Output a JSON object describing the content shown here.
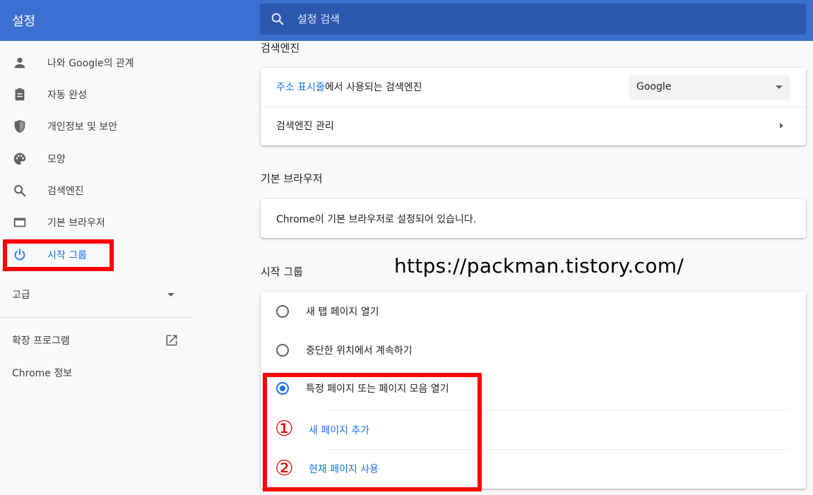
{
  "header": {
    "app_title": "설정",
    "search_placeholder": "설정 검색",
    "color": "#3c70d0"
  },
  "sidebar": {
    "items": [
      {
        "label": "나와 Google의 관계",
        "icon": "person-icon"
      },
      {
        "label": "자동 완성",
        "icon": "clipboard-icon"
      },
      {
        "label": "개인정보 및 보안",
        "icon": "shield-icon"
      },
      {
        "label": "모양",
        "icon": "palette-icon"
      },
      {
        "label": "검색엔진",
        "icon": "search-icon"
      },
      {
        "label": "기본 브라우저",
        "icon": "browser-window-icon"
      },
      {
        "label": "시작 그룹",
        "icon": "power-icon",
        "active": true
      }
    ],
    "advanced_label": "고급",
    "extensions_label": "확장 프로그램",
    "about_label": "Chrome 정보"
  },
  "search_engine": {
    "title": "검색엔진",
    "address_bar_link": "주소 표시줄",
    "address_bar_suffix": "에서 사용되는 검색엔진",
    "selected_engine": "Google",
    "manage_label": "검색엔진 관리"
  },
  "default_browser": {
    "title": "기본 브라우저",
    "status": "Chrome이 기본 브라우저로 설정되어 있습니다."
  },
  "startup": {
    "title": "시작 그룹",
    "options": [
      {
        "label": "새 탭 페이지 열기",
        "checked": false
      },
      {
        "label": "중단한 위치에서 계속하기",
        "checked": false
      },
      {
        "label": "특정 페이지 또는 페이지 모음 열기",
        "checked": true
      }
    ],
    "add_page_label": "새 페이지 추가",
    "use_current_label": "현재 페이지 사용",
    "marker_1": "①",
    "marker_2": "②"
  },
  "watermark": "https://packman.tistory.com/",
  "accent_color": "#1a73e8",
  "highlight_color": "#ff0000"
}
